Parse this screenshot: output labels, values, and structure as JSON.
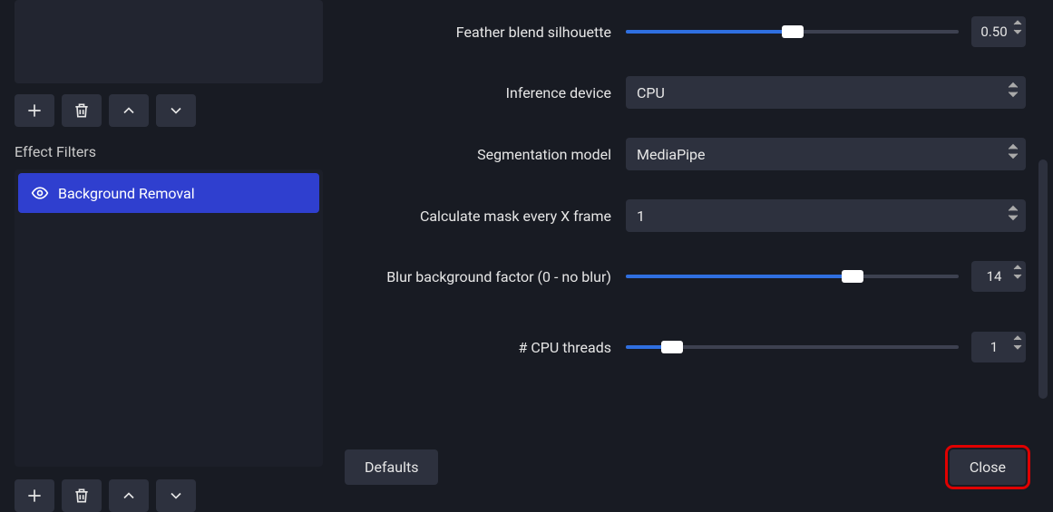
{
  "sidebar": {
    "section_title": "Effect Filters",
    "filters": [
      {
        "label": "Background Removal"
      }
    ]
  },
  "settings": {
    "feather": {
      "label": "Feather blend silhouette",
      "value": "0.50",
      "fill_pct": 50
    },
    "inference_device": {
      "label": "Inference device",
      "value": "CPU"
    },
    "segmentation_model": {
      "label": "Segmentation model",
      "value": "MediaPipe"
    },
    "mask_every_x": {
      "label": "Calculate mask every X frame",
      "value": "1"
    },
    "blur_factor": {
      "label": "Blur background factor (0 - no blur)",
      "value": "14",
      "fill_pct": 68
    },
    "cpu_threads": {
      "label": "# CPU threads",
      "value": "1",
      "fill_pct": 14
    }
  },
  "buttons": {
    "defaults": "Defaults",
    "close": "Close"
  }
}
